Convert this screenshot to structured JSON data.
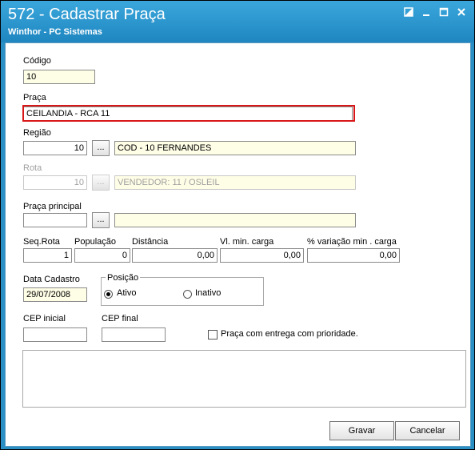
{
  "window": {
    "title": "572 - Cadastrar Praça",
    "subtitle": "Winthor - PC Sistemas",
    "buttons": [
      "restore-icon",
      "minimize-icon",
      "maximize-icon",
      "close-icon"
    ]
  },
  "form": {
    "codigo": {
      "label": "Código",
      "value": "10"
    },
    "praca": {
      "label": "Praça",
      "value": "CEILANDIA - RCA 11"
    },
    "regiao": {
      "label": "Região",
      "code": "10",
      "browse": "...",
      "desc": "COD - 10 FERNANDES"
    },
    "rota": {
      "label": "Rota",
      "code": "10",
      "browse": "...",
      "desc": "VENDEDOR: 11 / OSLEIL"
    },
    "praca_principal": {
      "label": "Praça principal",
      "code": "",
      "browse": "...",
      "desc": ""
    },
    "seq_rota": {
      "label": "Seq.Rota",
      "value": "1"
    },
    "populacao": {
      "label": "População",
      "value": "0"
    },
    "distancia": {
      "label": "Distância",
      "value": "0,00"
    },
    "vl_min_carga": {
      "label": "Vl. min. carga",
      "value": "0,00"
    },
    "pct_variacao": {
      "label": "% variação min . carga",
      "value": "0,00"
    },
    "data_cadastro": {
      "label": "Data Cadastro",
      "value": "29/07/2008"
    },
    "posicao": {
      "label": "Posição",
      "options": [
        "Ativo",
        "Inativo"
      ],
      "selected": "Ativo"
    },
    "cep_inicial": {
      "label": "CEP inicial",
      "value": ""
    },
    "cep_final": {
      "label": "CEP final",
      "value": ""
    },
    "prioridade": {
      "label": "Praça com entrega com prioridade.",
      "checked": false
    }
  },
  "actions": {
    "gravar": "Gravar",
    "cancelar": "Cancelar"
  },
  "colors": {
    "title_bar": "#1f86c0",
    "field_highlight": "#fefde6",
    "annotation_box": "#d81818"
  }
}
